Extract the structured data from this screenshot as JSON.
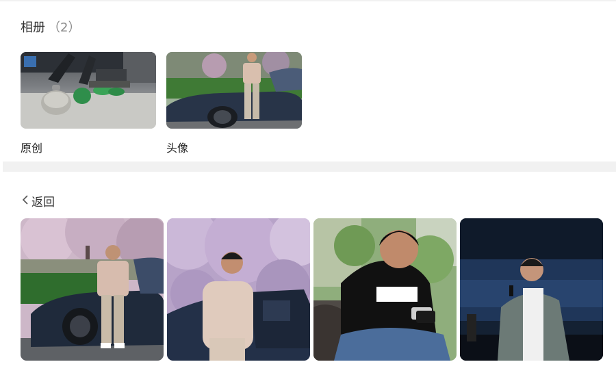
{
  "album_section": {
    "title": "相册",
    "count": "（2）",
    "albums": [
      {
        "label": "原创",
        "thumb": "gym-equipment-photo"
      },
      {
        "label": "头像",
        "thumb": "man-beside-car-photo"
      }
    ]
  },
  "back": {
    "label": "返回",
    "icon": "chevron-left-icon"
  },
  "photos": [
    {
      "name": "photo-man-car-blossoms"
    },
    {
      "name": "photo-man-cherry-tree"
    },
    {
      "name": "photo-man-black-tshirt-phone"
    },
    {
      "name": "photo-man-stage-speech"
    }
  ],
  "colors": {
    "separator": "#f1f1f1",
    "text": "#333333",
    "muted": "#8a8a8a"
  }
}
